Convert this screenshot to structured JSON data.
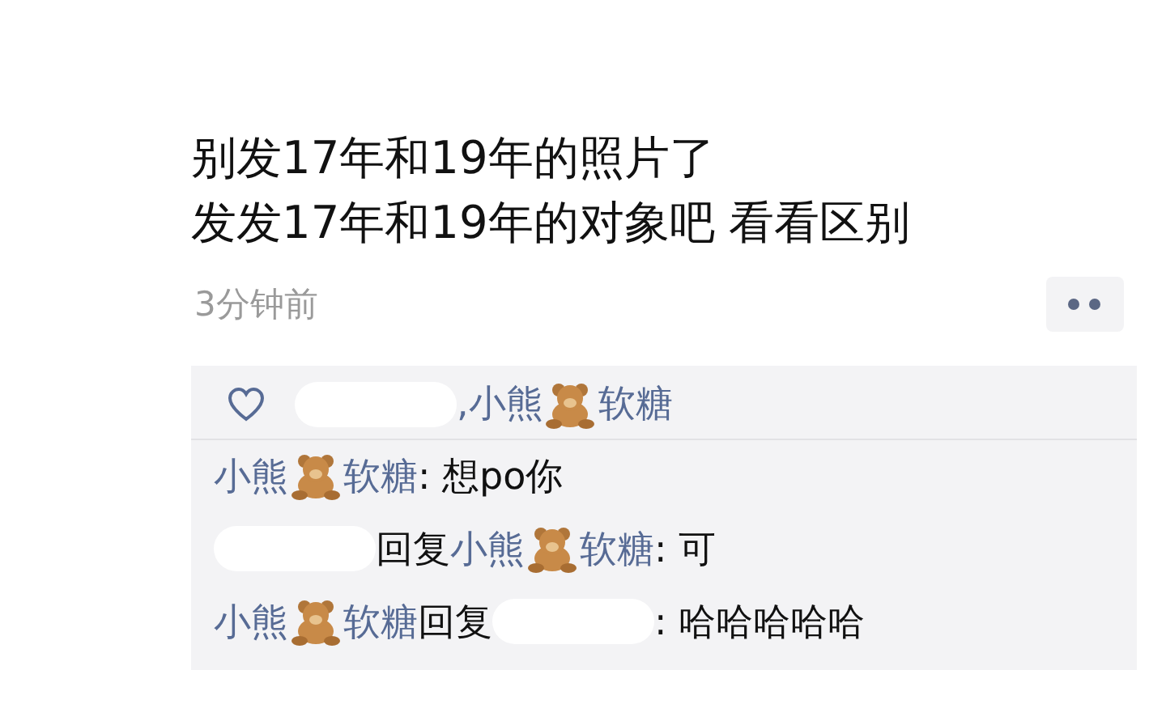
{
  "post": {
    "lines": [
      "别发17年和19年的照片了",
      "发发17年和19年的对象吧 看看区别"
    ],
    "time": "3分钟前"
  },
  "likes": {
    "separator": ",",
    "users": [
      {
        "redacted": true
      },
      {
        "redacted": false,
        "parts": [
          "小熊",
          "软糖"
        ]
      }
    ]
  },
  "comments": [
    {
      "kind": "comment",
      "author": {
        "redacted": false,
        "parts": [
          "小熊",
          "软糖"
        ]
      },
      "text": ": 想po你"
    },
    {
      "kind": "reply",
      "author": {
        "redacted": true
      },
      "reply_word": "回复",
      "reply_to": {
        "redacted": false,
        "parts": [
          "小熊",
          "软糖"
        ]
      },
      "text": ": 可"
    },
    {
      "kind": "reply",
      "author": {
        "redacted": false,
        "parts": [
          "小熊",
          "软糖"
        ]
      },
      "reply_word": "回复",
      "reply_to": {
        "redacted": true
      },
      "text": ": 哈哈哈哈哈"
    }
  ]
}
